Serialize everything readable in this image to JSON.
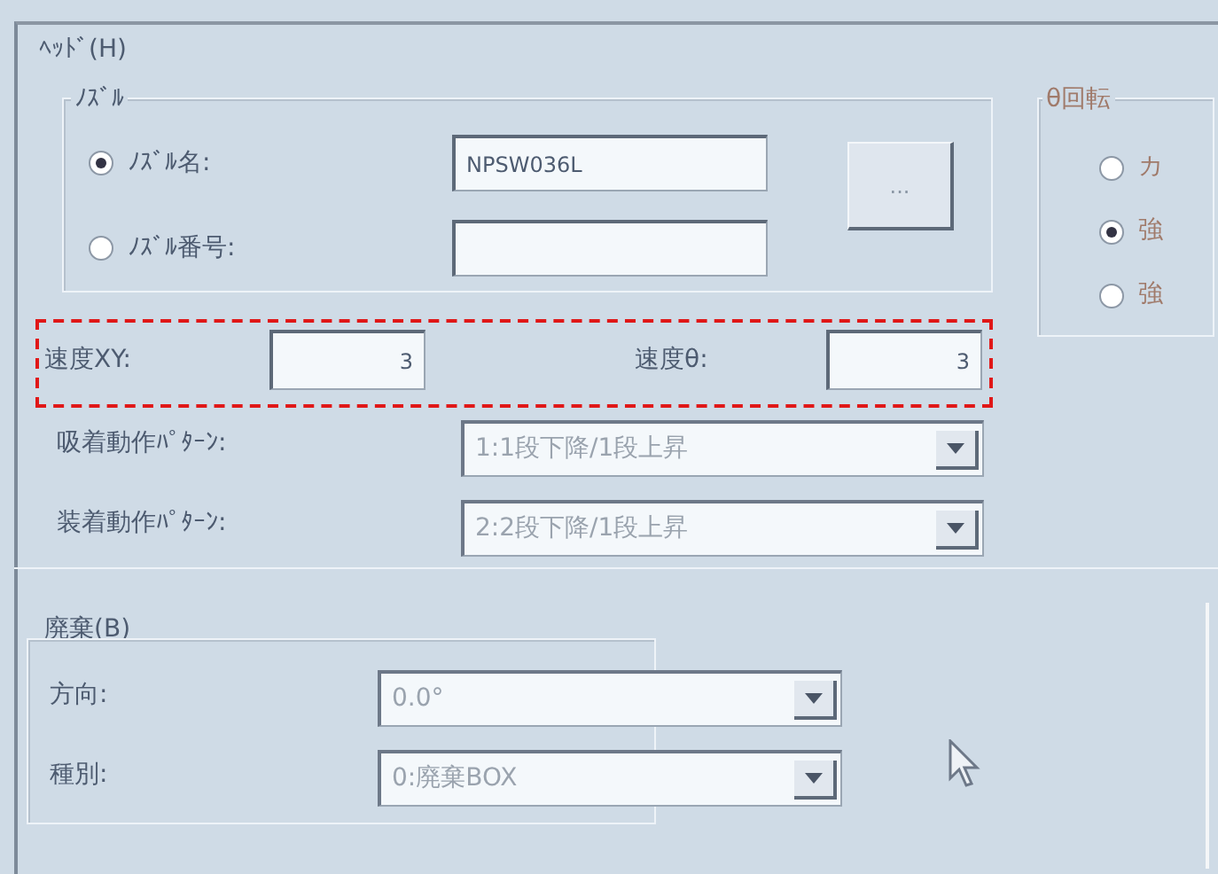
{
  "head_group": {
    "title": "ﾍｯﾄﾞ(H)",
    "nozzle_group": {
      "title": "ﾉｽﾞﾙ",
      "options": [
        {
          "label": "ﾉｽﾞﾙ名:",
          "selected": true,
          "value": "NPSW036L"
        },
        {
          "label": "ﾉｽﾞﾙ番号:",
          "selected": false
        }
      ],
      "browse_button": "..."
    },
    "rotation_group": {
      "title": "θ回転",
      "options": [
        {
          "label": "カ",
          "selected": false
        },
        {
          "label": "強",
          "selected": true
        },
        {
          "label": "強",
          "selected": false
        }
      ]
    },
    "speed_xy": {
      "label": "速度XY:",
      "value": "3"
    },
    "speed_theta": {
      "label": "速度θ:",
      "value": "3"
    },
    "dropdowns": [
      {
        "label": "吸着動作ﾊﾟﾀｰﾝ:",
        "value": "1:1段下降/1段上昇"
      },
      {
        "label": "装着動作ﾊﾟﾀｰﾝ:",
        "value": "2:2段下降/1段上昇"
      }
    ]
  },
  "disposal_group": {
    "title": "廃棄(B)",
    "dropdowns": [
      {
        "label": "方向:",
        "value": "0.0°"
      },
      {
        "label": "種別:",
        "value": "0:廃棄BOX"
      }
    ]
  }
}
